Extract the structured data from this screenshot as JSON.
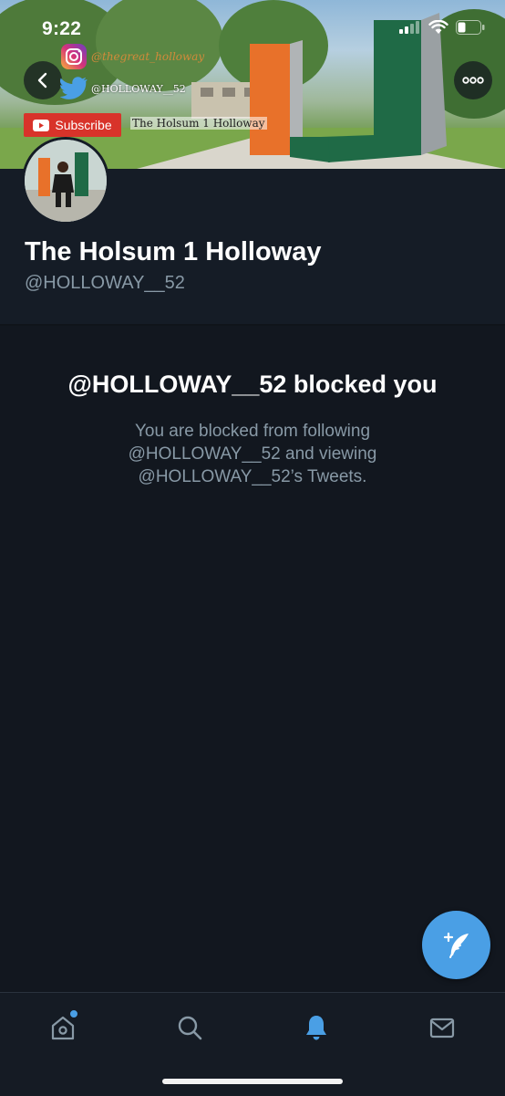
{
  "status_bar": {
    "time": "9:22"
  },
  "banner": {
    "instagram_label": "@thegreat_holloway",
    "twitter_label": "@HOLLOWAY__52",
    "youtube_button_label": "Subscribe",
    "youtube_channel_name": "The Holsum 1 Holloway"
  },
  "profile": {
    "display_name": "The Holsum 1 Holloway",
    "handle": "@HOLLOWAY__52"
  },
  "blocked": {
    "title": "@HOLLOWAY__52 blocked you",
    "description": "You are blocked from following @HOLLOWAY__52 and viewing @HOLLOWAY__52’s Tweets."
  },
  "tab_bar": {
    "items": [
      "home",
      "search",
      "notifications",
      "messages"
    ],
    "active": "notifications"
  },
  "colors": {
    "background": "#12171f",
    "accent": "#4a9fe5",
    "secondary_text": "#8899a6",
    "youtube_red": "#d8332a"
  }
}
